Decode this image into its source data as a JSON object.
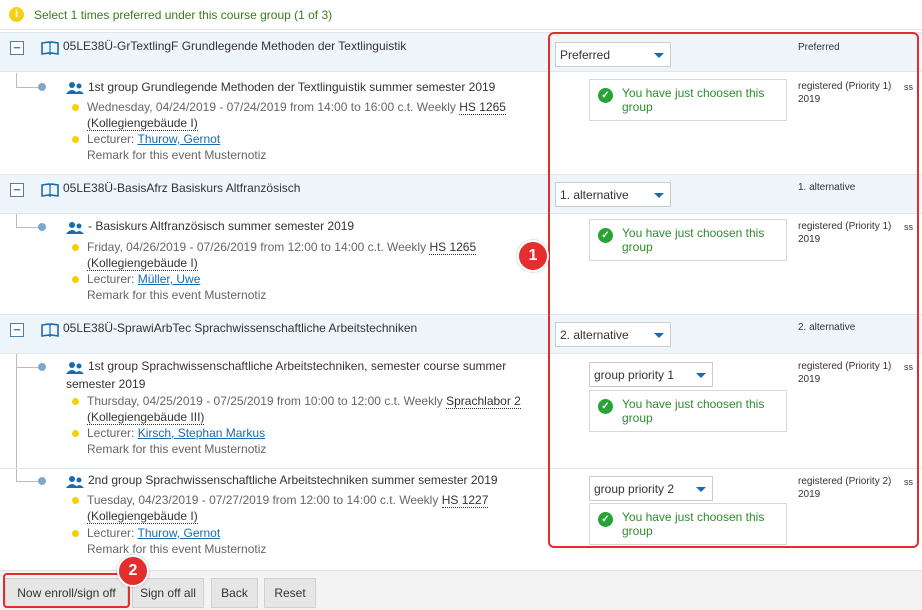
{
  "info": {
    "icon": "info-icon",
    "text": "Select 1 times preferred under this course group (1 of 3)"
  },
  "courses": [
    {
      "title": "05LE38Ü-GrTextlingF Grundlegende Methoden der Textlinguistik",
      "priority_select": "Preferred",
      "side_label": "Preferred",
      "groups": [
        {
          "title_line1": "1st group Grundlegende Methoden der Textlinguistik summer semester 2019",
          "title_line2": "",
          "schedule": "Wednesday, 04/24/2019 - 07/24/2019 from 14:00 to 16:00 c.t. Weekly",
          "room": "HS 1265",
          "building": "(Kollegiengebäude I)",
          "lecturer_label": "Lecturer:",
          "lecturer": "Thurow, Gernot",
          "remark": "Remark for this event Musternotiz",
          "group_select": "",
          "status": "You have just choosen this group",
          "side_label_1": "registered (Priority 1)",
          "side_label_2": "2019",
          "ss": "ss"
        }
      ]
    },
    {
      "title": "05LE38Ü-BasisAfrz Basiskurs Altfranzösisch",
      "priority_select": "1. alternative",
      "side_label": "1. alternative",
      "groups": [
        {
          "title_line1": "- Basiskurs Altfranzösisch summer semester 2019",
          "title_line2": "",
          "schedule": "Friday, 04/26/2019 - 07/26/2019 from 12:00 to 14:00 c.t. Weekly",
          "room": "HS 1265",
          "building": "(Kollegiengebäude I)",
          "lecturer_label": "Lecturer:",
          "lecturer": "Müller, Uwe",
          "remark": "Remark for this event Musternotiz",
          "group_select": "",
          "status": "You have just choosen this group",
          "side_label_1": "registered (Priority 1)",
          "side_label_2": "2019",
          "ss": "ss"
        }
      ]
    },
    {
      "title": "05LE38Ü-SprawiArbTec Sprachwissenschaftliche Arbeitstechniken",
      "priority_select": "2. alternative",
      "side_label": "2. alternative",
      "groups": [
        {
          "title_line1": "1st group Sprachwissenschaftliche Arbeitstechniken, semester course summer",
          "title_line2": "semester 2019",
          "schedule": "Thursday, 04/25/2019 - 07/25/2019 from 10:00 to 12:00 c.t. Weekly",
          "room": "Sprachlabor 2",
          "building": "(Kollegiengebäude III)",
          "lecturer_label": "Lecturer:",
          "lecturer": "Kirsch, Stephan Markus",
          "remark": "Remark for this event Musternotiz",
          "group_select": "group priority 1",
          "status": "You have just choosen this group",
          "side_label_1": "registered (Priority 1)",
          "side_label_2": "2019",
          "ss": "ss"
        },
        {
          "title_line1": "2nd group Sprachwissenschaftliche Arbeitstechniken summer semester 2019",
          "title_line2": "",
          "schedule": "Tuesday, 04/23/2019 - 07/27/2019 from 12:00 to 14:00 c.t. Weekly",
          "room": "HS 1227",
          "building": "(Kollegiengebäude I)",
          "lecturer_label": "Lecturer:",
          "lecturer": "Thurow, Gernot",
          "remark": "Remark for this event Musternotiz",
          "group_select": "group priority 2",
          "status": "You have just choosen this group",
          "side_label_1": "registered (Priority 2)",
          "side_label_2": "2019",
          "ss": "ss"
        }
      ]
    }
  ],
  "markers": {
    "one": "1",
    "two": "2"
  },
  "footer": {
    "enroll": "Now enroll/sign off",
    "sign_off_all": "Sign off all",
    "back": "Back",
    "reset": "Reset"
  },
  "colors": {
    "highlight": "#e42d2d",
    "success": "#2e8b2e",
    "link": "#1a6bb0"
  }
}
